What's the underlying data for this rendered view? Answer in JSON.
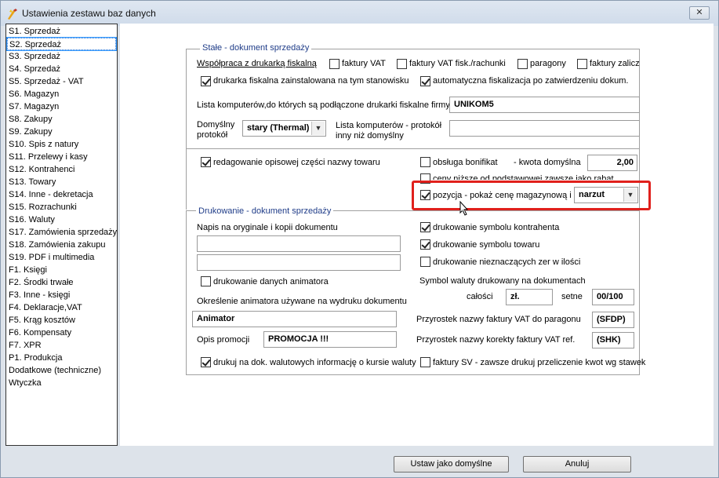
{
  "window": {
    "title": "Ustawienia zestawu baz danych",
    "close_label": "✕"
  },
  "sidebar": {
    "items": [
      "S1. Sprzedaż",
      "S2. Sprzedaż",
      "S3. Sprzedaż",
      "S4. Sprzedaż",
      "S5. Sprzedaż - VAT",
      "S6. Magazyn",
      "S7. Magazyn",
      "S8. Zakupy",
      "S9. Zakupy",
      "S10. Spis z natury",
      "S11. Przelewy i kasy",
      "S12. Kontrahenci",
      "S13. Towary",
      "S14. Inne - dekretacja",
      "S15. Rozrachunki",
      "S16. Waluty",
      "S17. Zamówienia sprzedaży",
      "S18. Zamówienia zakupu",
      "S19. PDF i multimedia",
      "F1. Księgi",
      "F2. Środki trwałe",
      "F3. Inne - księgi",
      "F4. Deklaracje,VAT",
      "F5. Krąg kosztów",
      "F6. Kompensaty",
      "F7. XPR",
      "P1. Produkcja",
      "Dodatkowe (techniczne)",
      "Wtyczka"
    ],
    "selected_index": 1
  },
  "group1": {
    "title": "Stałe - dokument sprzedaży",
    "fiscal_label": "Współpraca z drukarką fiskalną",
    "cb_faktury_vat": "faktury VAT",
    "cb_faktury_vat_fisk": "faktury VAT fisk./rachunki",
    "cb_paragony": "paragony",
    "cb_faktury_zalicz": "faktury zalicz",
    "cb_drukarka": "drukarka fiskalna zainstalowana na tym stanowisku",
    "cb_auto_fisk": "automatyczna fiskalizacja po zatwierdzeniu dokum.",
    "computers_label": "Lista komputerów,do których są podłączone drukarki fiskalne firmy",
    "computers_value": "UNIKOM5",
    "protocol_label_1": "Domyślny",
    "protocol_label_2": "protokół",
    "protocol_value": "stary (Thermal)",
    "other_protocol_label_1": "Lista komputerów - protokół",
    "other_protocol_label_2": "inny niż domyślny",
    "other_protocol_value": "",
    "cb_redagowanie": "redagowanie opisowej części nazwy towaru",
    "cb_bonifikat": "obsługa bonifikat",
    "kwota_label": "- kwota domyślna",
    "kwota_value": "2,00",
    "cb_ceny_nizsze": "ceny niższe od podstawowej zawsze jako rabat",
    "cb_pozycja": "pozycja - pokaż cenę magazynową i",
    "narzut_value": "narzut"
  },
  "group2": {
    "title": "Drukowanie - dokument sprzedaży",
    "napis_label": "Napis na oryginale i kopii dokumentu",
    "napis_1": "",
    "napis_2": "",
    "cb_symbol_kontrahenta": "drukowanie symbolu kontrahenta",
    "cb_symbol_towaru": "drukowanie symbolu towaru",
    "cb_zer": "drukowanie nieznaczących zer w ilości",
    "cb_animatora": "drukowanie danych animatora",
    "symbol_waluty_label": "Symbol waluty drukowany na dokumentach",
    "calosci_label": "całości",
    "calosci_value": "zł.",
    "setne_label": "setne",
    "setne_value": "00/100",
    "animator_label": "Określenie animatora używane na wydruku dokumentu",
    "animator_value": "Animator",
    "przyrostek_vat_label": "Przyrostek nazwy faktury VAT do paragonu",
    "przyrostek_vat_value": "(SFDP)",
    "opis_promocji_label": "Opis promocji",
    "opis_promocji_value": "PROMOCJA !!!",
    "przyrostek_korekty_label": "Przyrostek nazwy korekty faktury VAT ref.",
    "przyrostek_korekty_value": "(SHK)",
    "cb_walutowe": "drukuj na dok. walutowych informację o kursie waluty",
    "cb_faktury_sv": "faktury SV - zawsze drukuj przeliczenie kwot wg stawek"
  },
  "buttons": {
    "set_default": "Ustaw jako domyślne",
    "cancel": "Anuluj"
  }
}
